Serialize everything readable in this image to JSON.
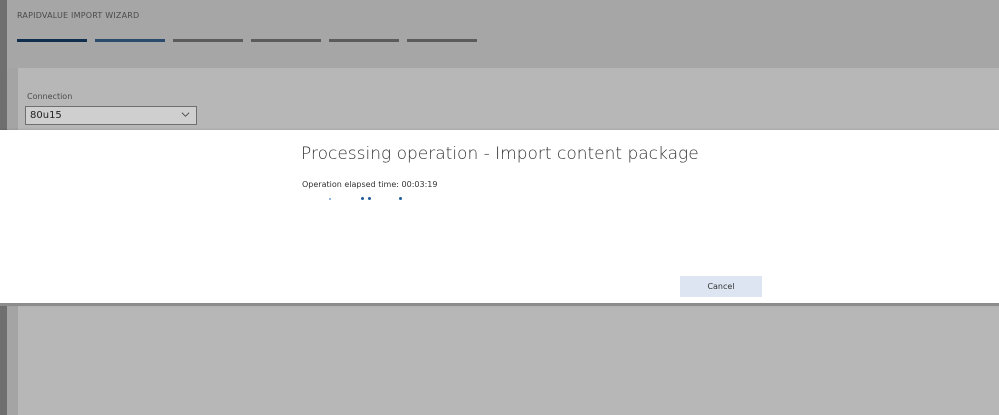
{
  "wizard": {
    "title": "RAPIDVALUE IMPORT WIZARD",
    "steps": [
      {
        "state": "done"
      },
      {
        "state": "current"
      },
      {
        "state": "pending"
      },
      {
        "state": "pending"
      },
      {
        "state": "pending"
      },
      {
        "state": "pending"
      }
    ],
    "current_step": 2,
    "total_steps": 6
  },
  "form": {
    "connection_label": "Connection",
    "connection_value": "80u15",
    "connection_icon": "chevron-down-icon"
  },
  "modal": {
    "title": "Processing operation - Import content package",
    "elapsed_label": "Operation elapsed time:",
    "elapsed_time": "00:03:19",
    "cancel_label": "Cancel",
    "progress_icon": "loading-dots-icon"
  },
  "colors": {
    "step_done": "#102e4e",
    "step_current": "#2b4b6c",
    "step_pending": "#5b5b5b",
    "cancel_bg": "#dce5f1",
    "progress_dot": "#1f5d9c",
    "overlay_bg": "#a4a4a4"
  }
}
